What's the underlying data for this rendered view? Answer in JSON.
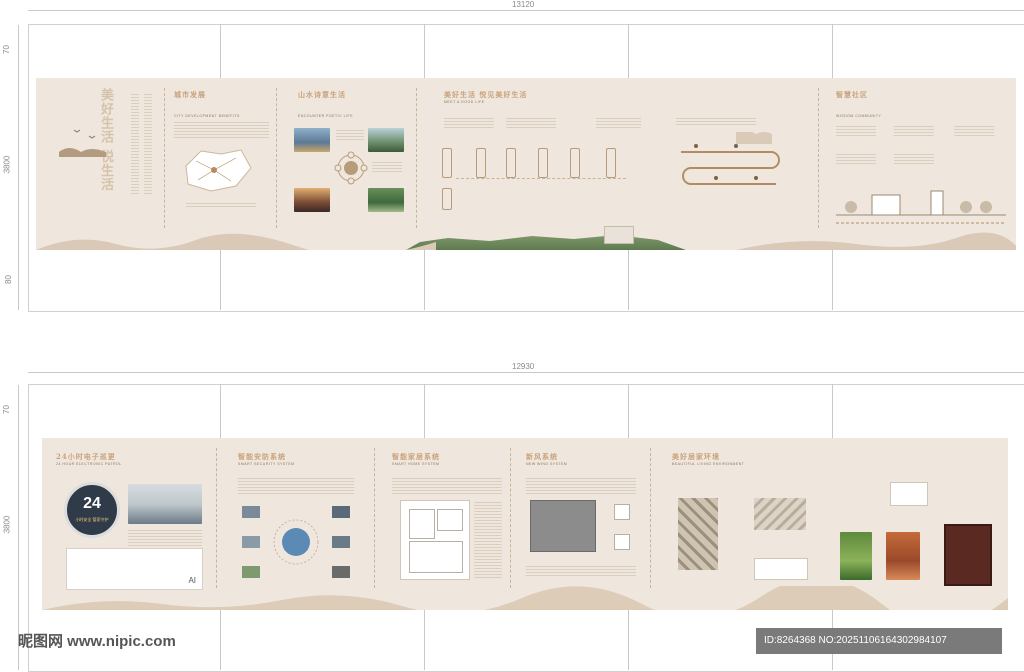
{
  "dimensions": {
    "top_width": "13120",
    "bottom_width": "12930",
    "top_height": "3800",
    "bottom_height": "3800",
    "top_margin": "70",
    "bottom_margin": "80",
    "lower_top_margin": "70"
  },
  "top_board": {
    "sections": [
      {
        "title": "城市发展",
        "subtitle": "CITY DEVELOPMENT BENEFITS"
      },
      {
        "title": "山水诗意生活",
        "subtitle": "ENCOUNTER POETIC LIFE"
      },
      {
        "title": "美好生活 悦见美好生活",
        "subtitle": "MEET A GOOD LIFE"
      },
      {
        "title": "智慧社区",
        "subtitle": "WISDOM COMMUNITY"
      }
    ],
    "intro_title": "美好生活 悦生活"
  },
  "bottom_board": {
    "sections": [
      {
        "title": "24小时电子巡更",
        "subtitle": "24 HOUR ELECTRONIC PATROL"
      },
      {
        "title": "智能安防系统",
        "subtitle": "SMART SECURITY SYSTEM"
      },
      {
        "title": "智能家居系统",
        "subtitle": "SMART HOME SYSTEM"
      },
      {
        "title": "新风系统",
        "subtitle": "NEW WIND SYSTEM"
      },
      {
        "title": "美好居家环境",
        "subtitle": "BEAUTIFUL LIVING ENVIRONMENT"
      }
    ],
    "badge_number": "24",
    "badge_text": "小时安全 管家守护",
    "ai_label": "AI"
  },
  "watermark": {
    "left": "昵图网 www.nipic.com",
    "right": "ID:8264368 NO:20251106164302984107"
  },
  "colors": {
    "panel": "#efe7de",
    "accent": "#c9a27a",
    "text": "#6b5a43"
  }
}
